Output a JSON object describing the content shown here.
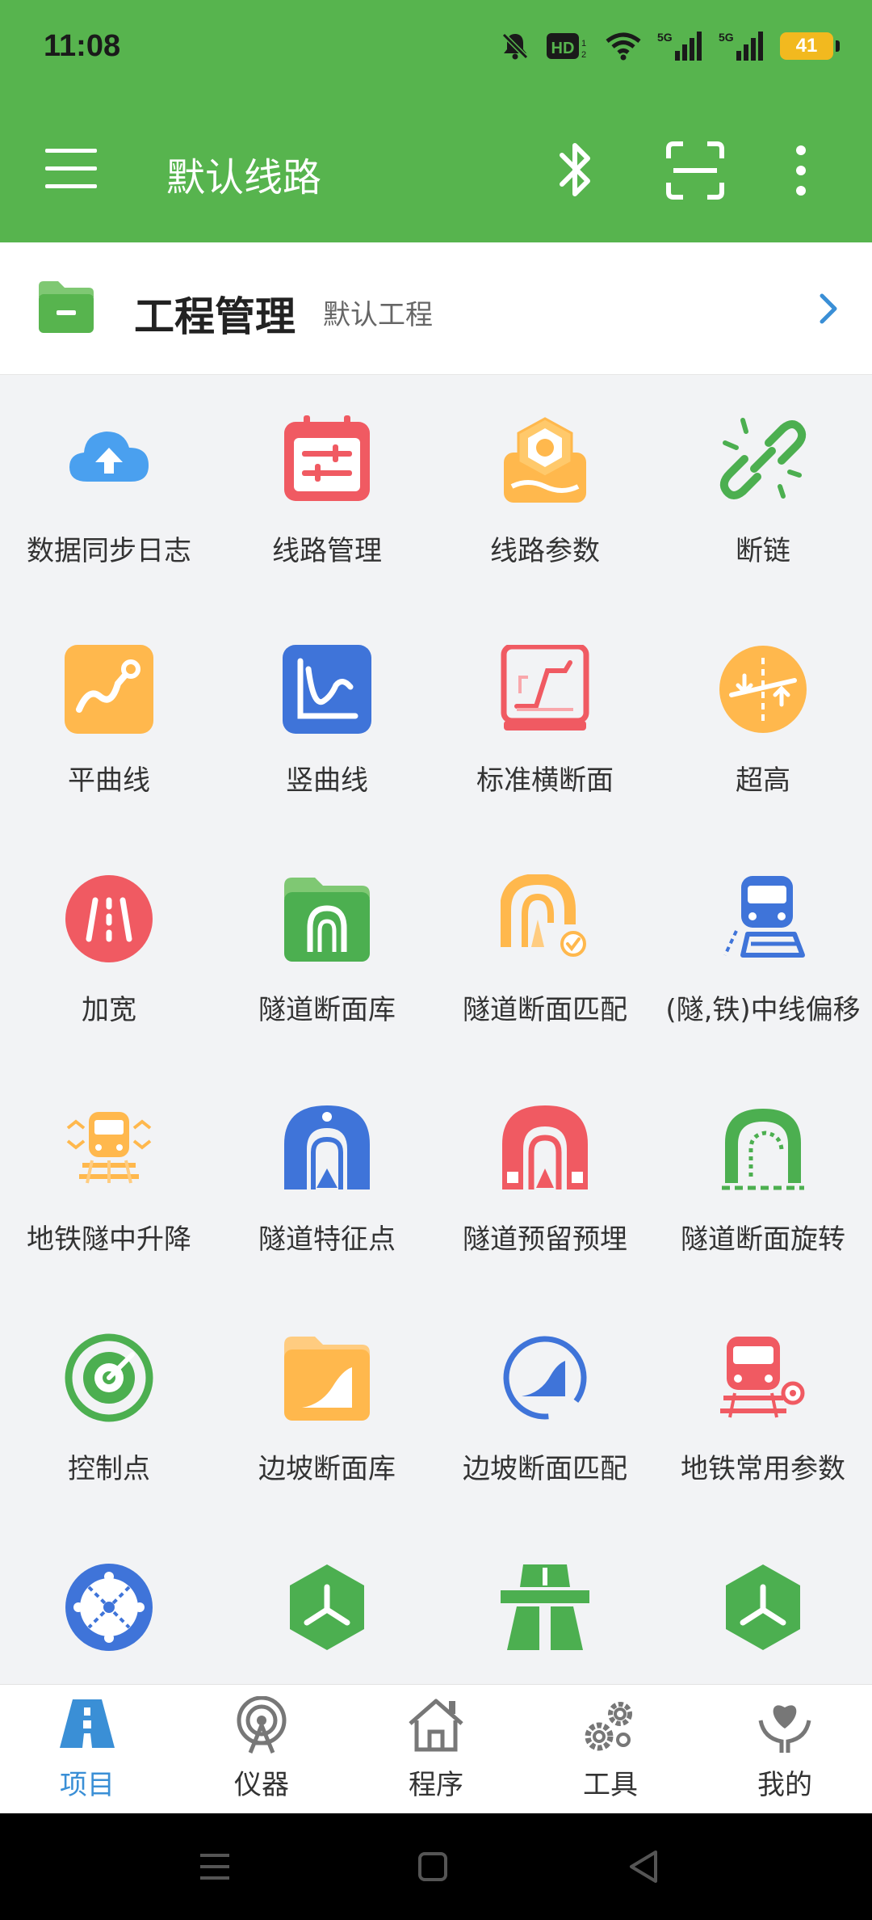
{
  "status": {
    "time": "11:08",
    "battery": "41",
    "hd_badge": "HD",
    "signal1": "5G",
    "signal2": "5G"
  },
  "toolbar": {
    "title": "默认线路"
  },
  "project": {
    "title": "工程管理",
    "subtitle": "默认工程"
  },
  "grid": [
    {
      "label": "数据同步日志",
      "icon": "cloud-upload-icon"
    },
    {
      "label": "线路管理",
      "icon": "calendar-icon"
    },
    {
      "label": "线路参数",
      "icon": "nut-icon"
    },
    {
      "label": "断链",
      "icon": "broken-link-icon"
    },
    {
      "label": "平曲线",
      "icon": "horizontal-curve-icon"
    },
    {
      "label": "竖曲线",
      "icon": "vertical-curve-icon"
    },
    {
      "label": "标准横断面",
      "icon": "cross-section-icon"
    },
    {
      "label": "超高",
      "icon": "superelevation-icon"
    },
    {
      "label": "加宽",
      "icon": "widening-icon"
    },
    {
      "label": "隧道断面库",
      "icon": "tunnel-folder-icon"
    },
    {
      "label": "隧道断面匹配",
      "icon": "tunnel-match-icon"
    },
    {
      "label": "(隧,铁)中线偏移",
      "icon": "train-offset-icon"
    },
    {
      "label": "地铁隧中升降",
      "icon": "subway-lift-icon"
    },
    {
      "label": "隧道特征点",
      "icon": "tunnel-feature-icon"
    },
    {
      "label": "隧道预留预埋",
      "icon": "tunnel-reserve-icon"
    },
    {
      "label": "隧道断面旋转",
      "icon": "tunnel-rotate-icon"
    },
    {
      "label": "控制点",
      "icon": "control-point-icon"
    },
    {
      "label": "边坡断面库",
      "icon": "slope-folder-icon"
    },
    {
      "label": "边坡断面匹配",
      "icon": "slope-match-icon"
    },
    {
      "label": "地铁常用参数",
      "icon": "train-settings-icon"
    },
    {
      "label": "",
      "icon": "network-circle-icon"
    },
    {
      "label": "",
      "icon": "hexagon-icon"
    },
    {
      "label": "",
      "icon": "highway-icon"
    },
    {
      "label": "",
      "icon": "hexagon-icon"
    }
  ],
  "bottom_nav": [
    {
      "label": "项目",
      "icon": "road-icon",
      "active": true
    },
    {
      "label": "仪器",
      "icon": "antenna-icon",
      "active": false
    },
    {
      "label": "程序",
      "icon": "home-icon",
      "active": false
    },
    {
      "label": "工具",
      "icon": "gears-icon",
      "active": false
    },
    {
      "label": "我的",
      "icon": "user-heart-icon",
      "active": false
    }
  ],
  "colors": {
    "green": "#57b44e",
    "blue": "#3a8fd6",
    "red": "#f05a62",
    "orange": "#ffb84d",
    "royal": "#3f74d9"
  }
}
